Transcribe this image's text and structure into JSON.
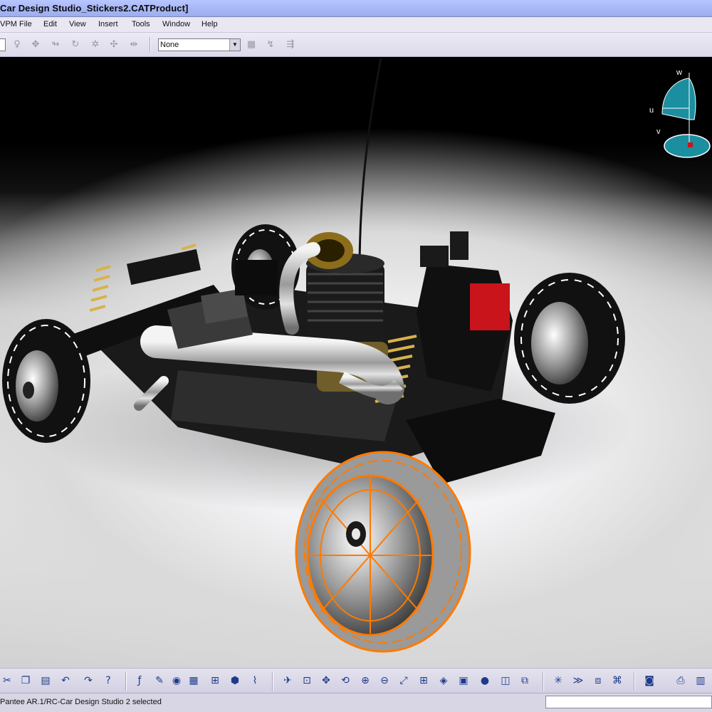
{
  "window": {
    "title": "Car Design Studio_Stickers2.CATProduct]"
  },
  "menu": [
    {
      "label": "VPM"
    },
    {
      "label": "File"
    },
    {
      "label": "Edit"
    },
    {
      "label": "View"
    },
    {
      "label": "Insert"
    },
    {
      "label": "Tools"
    },
    {
      "label": "Window"
    },
    {
      "label": "Help"
    }
  ],
  "toolbar": {
    "filter_value": "None",
    "combo_arrow": "▼"
  },
  "compass": {
    "label_w": "w",
    "label_u": "u",
    "label_v": "v"
  },
  "icons": {
    "top": [
      "pointer-icon",
      "snap-icon",
      "move-icon",
      "rotate-icon",
      "explode-icon",
      "manipulate-icon",
      "assemble-icon",
      "clash-icon",
      "annotation-icon",
      "filter-icon"
    ],
    "bottom": [
      "cut-icon",
      "copy-icon",
      "paste-icon",
      "undo-icon",
      "redo-icon",
      "whats-this-icon",
      "formula-icon",
      "comment-icon",
      "macro-icon",
      "table-icon",
      "graph-icon",
      "catalog-icon",
      "knowledge-icon",
      "fly-icon",
      "fit-all-icon",
      "pan-icon",
      "rotate-view-icon",
      "zoom-in-icon",
      "zoom-out-icon",
      "normal-view-icon",
      "multi-view-icon",
      "iso-view-icon",
      "render-style-icon",
      "material-icon",
      "hide-show-icon",
      "swap-space-icon",
      "measure-icon",
      "drive-icon",
      "connect-icon",
      "camera-icon",
      "print-icon",
      "notebook-icon"
    ]
  },
  "colors": {
    "titlebar": "#aab9f7",
    "selection": "#ff7a00",
    "compass": "#1b8fa0"
  },
  "status": {
    "text": "Pantee AR.1/RC-Car Design Studio 2 selected"
  }
}
